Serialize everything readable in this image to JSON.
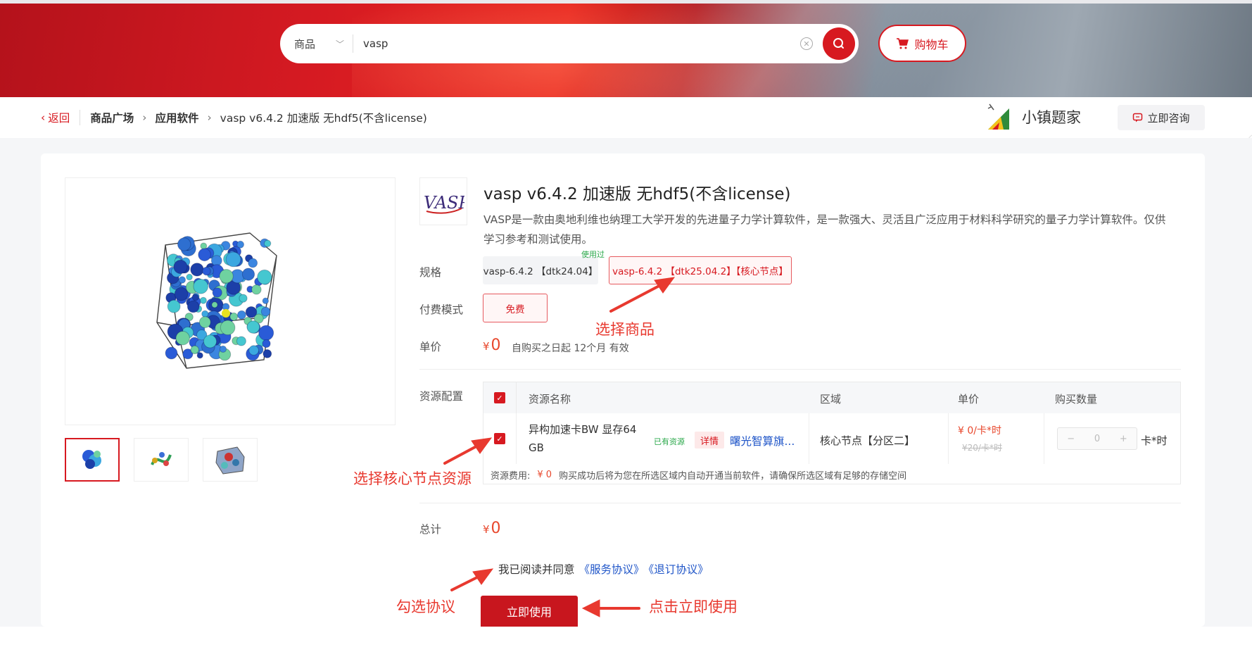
{
  "search": {
    "category": "商品",
    "query": "vasp"
  },
  "header": {
    "cart_label": "购物车"
  },
  "breadcrumb": {
    "back": "返回",
    "items": [
      "商品广场",
      "应用软件",
      "vasp v6.4.2 加速版 无hdf5(不含license)"
    ]
  },
  "brand": {
    "name": "小镇题家",
    "consult": "立即咨询"
  },
  "product": {
    "title": "vasp v6.4.2 加速版 无hdf5(不含license)",
    "description": "VASP是一款由奥地利维也纳理工大学开发的先进量子力学计算软件，是一款强大、灵活且广泛应用于材料科学研究的量子力学计算软件。仅供学习参考和测试使用。",
    "spec_label": "规格",
    "specs": [
      "vasp-6.4.2 【dtk24.04】",
      "vasp-6.4.2 【dtk25.04.2】【核心节点】"
    ],
    "spec_used_tag": "使用过",
    "pay_label": "付费模式",
    "pay_mode": "免费",
    "price_label": "单价",
    "currency": "¥",
    "price": "0",
    "validity": "自购买之日起 12个月 有效",
    "resource_label": "资源配置",
    "total_label": "总计",
    "total": "0"
  },
  "resource_table": {
    "headers": [
      "资源名称",
      "区域",
      "单价",
      "购买数量"
    ],
    "row": {
      "name_line1": "异构加速卡BW 显存64",
      "name_line2": "GB",
      "have_tag": "已有资源",
      "detail_tag": "详情",
      "vendor": "曙光智算旗...",
      "region": "核心节点【分区二】",
      "price": "¥ 0/卡*时",
      "original_price": "¥20/卡*时",
      "qty": "0",
      "qty_minus": "−",
      "qty_plus": "+",
      "unit": "卡*时"
    },
    "footer_label": "资源费用:",
    "footer_amount": "¥ 0",
    "footer_note": "购买成功后将为您在所选区域内自动开通当前软件，请确保所选区域有足够的存储空间"
  },
  "agreement": {
    "text": "我已阅读并同意",
    "service": "《服务协议》",
    "unsubscribe": "《退订协议》"
  },
  "actions": {
    "use_now": "立即使用"
  },
  "annotations": {
    "select_product": "选择商品",
    "select_node": "选择核心节点资源",
    "check_agreement": "勾选协议",
    "click_use": "点击立即使用"
  },
  "colors": {
    "accent": "#d71920",
    "price": "#e8472c",
    "link": "#1f55c8",
    "annotation": "#e8392f"
  }
}
